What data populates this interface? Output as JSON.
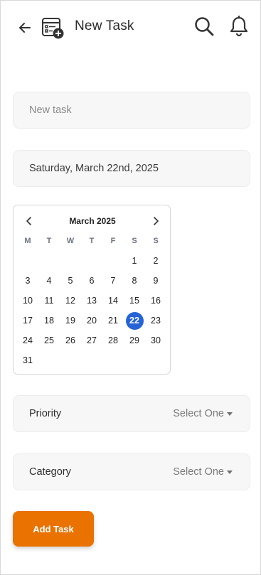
{
  "header": {
    "title": "New Task",
    "back_icon": "arrow-left-icon",
    "app_icon": "task-add-icon",
    "search_icon": "search-icon",
    "notification_icon": "bell-icon"
  },
  "task_input": {
    "placeholder": "New task",
    "value": ""
  },
  "date_field": {
    "value": "Saturday, March 22nd, 2025"
  },
  "calendar": {
    "month_label": "March 2025",
    "weekdays": [
      "M",
      "T",
      "W",
      "T",
      "F",
      "S",
      "S"
    ],
    "leading_blanks": 5,
    "days": [
      1,
      2,
      3,
      4,
      5,
      6,
      7,
      8,
      9,
      10,
      11,
      12,
      13,
      14,
      15,
      16,
      17,
      18,
      19,
      20,
      21,
      22,
      23,
      24,
      25,
      26,
      27,
      28,
      29,
      30,
      31
    ],
    "selected_day": 22,
    "selected_color": "#2563d6"
  },
  "priority": {
    "label": "Priority",
    "value": "Select One"
  },
  "category": {
    "label": "Category",
    "value": "Select One"
  },
  "add_button": {
    "label": "Add Task",
    "color": "#e97200"
  }
}
